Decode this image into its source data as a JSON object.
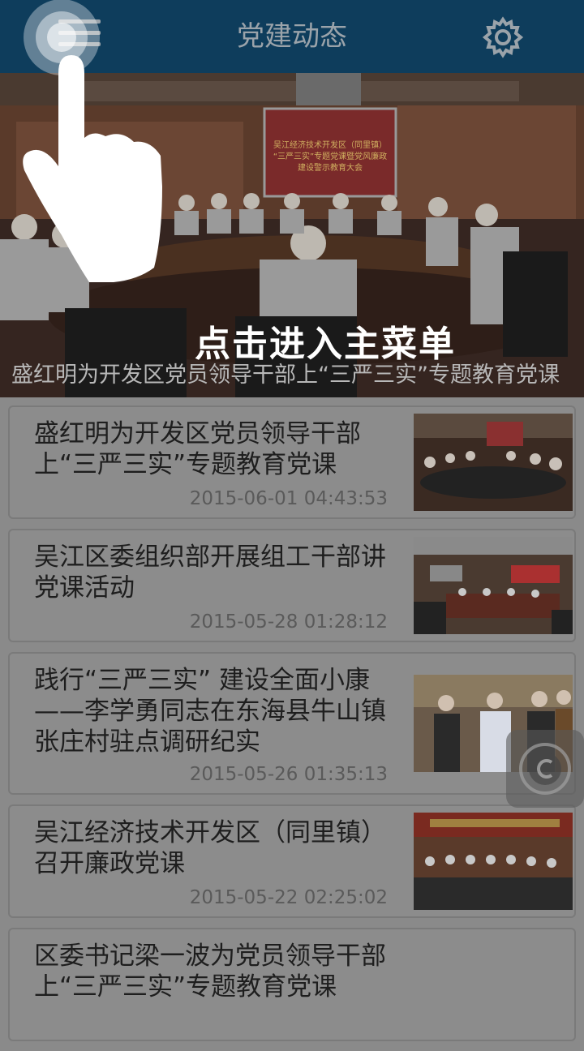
{
  "header": {
    "title": "党建动态",
    "menu_icon": "hamburger-menu-icon",
    "settings_icon": "gear-icon",
    "background": "#0e3d5c"
  },
  "hero": {
    "caption": "盛红明为开发区党员领导干部上“三严三实”专题教育党课",
    "hint": "点击进入主菜单",
    "screen_text": "吴江经济技术开发区（同里镇）“三严三实”专题党课暨党风廉政建设警示教育大会"
  },
  "news": [
    {
      "title": "盛红明为开发区党员领导干部上“三严三实”专题教育党课",
      "date": "2015-06-01 04:43:53"
    },
    {
      "title": "吴江区委组织部开展组工干部讲党课活动",
      "date": "2015-05-28 01:28:12"
    },
    {
      "title": "践行“三严三实” 建设全面小康——李学勇同志在东海县牛山镇张庄村驻点调研纪实",
      "date": "2015-05-26 01:35:13"
    },
    {
      "title": "吴江经济技术开发区（同里镇）召开廉政党课",
      "date": "2015-05-22 02:25:02"
    },
    {
      "title": "区委书记梁一波为党员领导干部上“三严三实”专题教育党课",
      "date": ""
    }
  ],
  "overlay": {
    "tutorial_icon": "pointing-hand-icon",
    "floating_button_icon": "floating-assistant-icon"
  }
}
